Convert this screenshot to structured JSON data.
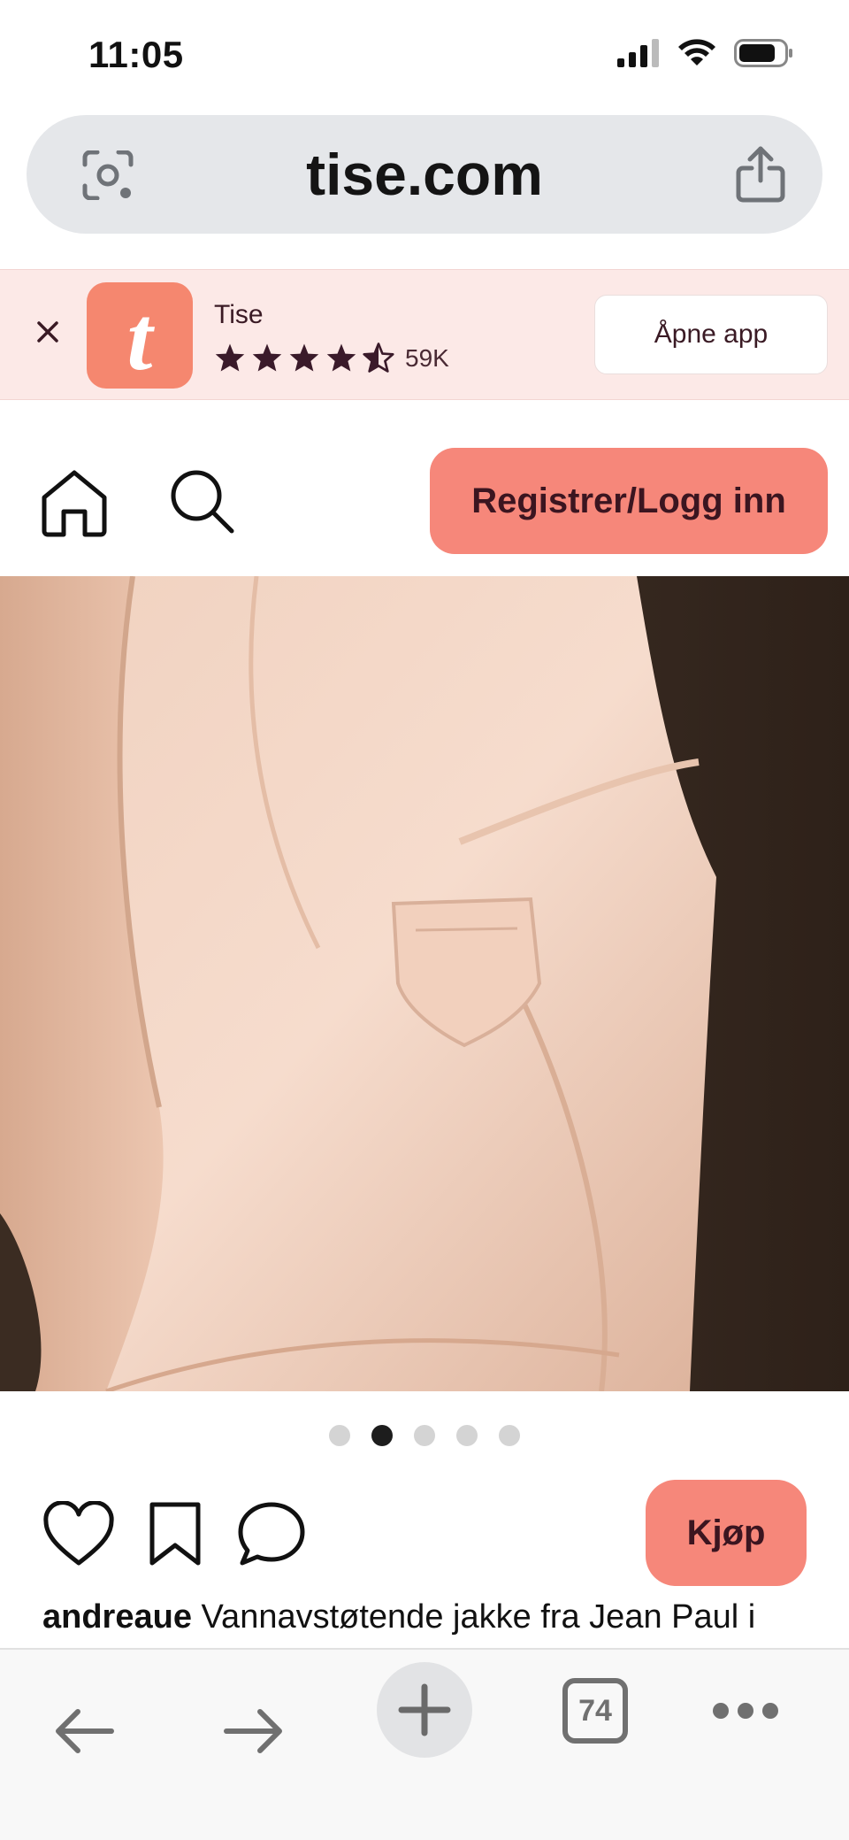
{
  "status_bar": {
    "time": "11:05",
    "icons": [
      "signal-icon",
      "wifi-icon",
      "battery-icon"
    ]
  },
  "browser": {
    "url": "tise.com",
    "left_icon": "camera-scan-icon",
    "right_icon": "share-icon",
    "tab_count": "74",
    "toolbar_icons": [
      "back-icon",
      "forward-icon",
      "plus-icon",
      "tabs-icon",
      "more-icon"
    ]
  },
  "app_banner": {
    "app_name": "Tise",
    "logo_letter": "t",
    "rating_stars": 4.5,
    "rating_count": "59K",
    "open_button": "Åpne app",
    "colors": {
      "background": "#fce9e7",
      "logo": "#f5876f",
      "text": "#3a1a24"
    }
  },
  "site_nav": {
    "register_button": "Registrer/Logg inn",
    "icons": [
      "home-icon",
      "search-icon"
    ],
    "accent_color": "#f6877a"
  },
  "product": {
    "image_description_icon": "product-photo",
    "slides_total": 5,
    "active_slide": 2,
    "buy_button": "Kjøp",
    "username": "andreaue",
    "caption": "Vannavstøtende jakke fra Jean Paul i"
  }
}
